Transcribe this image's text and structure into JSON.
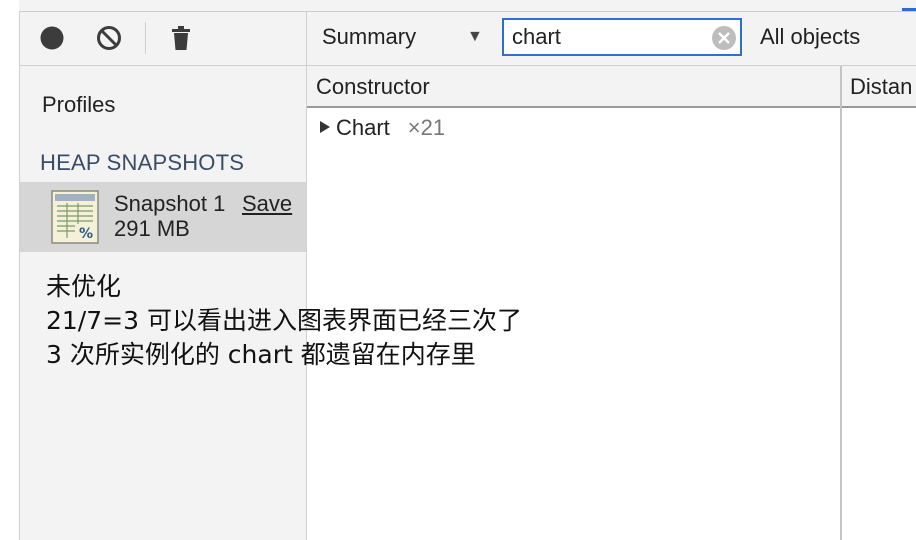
{
  "toolbar": {
    "icons": [
      "record-icon",
      "clear-icon",
      "trash-icon"
    ]
  },
  "sidebar": {
    "title": "Profiles",
    "section_header": "HEAP SNAPSHOTS",
    "snapshot": {
      "name": "Snapshot 1",
      "save_label": "Save",
      "size": "291 MB"
    }
  },
  "filter_bar": {
    "view": "Summary",
    "filter_value": "chart",
    "objects_scope": "All objects"
  },
  "grid": {
    "columns": [
      "Constructor",
      "Distan"
    ],
    "rows": [
      {
        "constructor": "Chart",
        "count": "×21"
      }
    ]
  },
  "annotation": {
    "lines": [
      "未优化",
      "21/7=3 可以看出进入图表界面已经三次了",
      "3 次所实例化的 chart 都遗留在内存里"
    ]
  },
  "colors": {
    "accent": "#2f6fd0",
    "panel_bg": "#f3f3f3",
    "selected_bg": "#d6d6d6",
    "section_header": "#3a4c66"
  }
}
